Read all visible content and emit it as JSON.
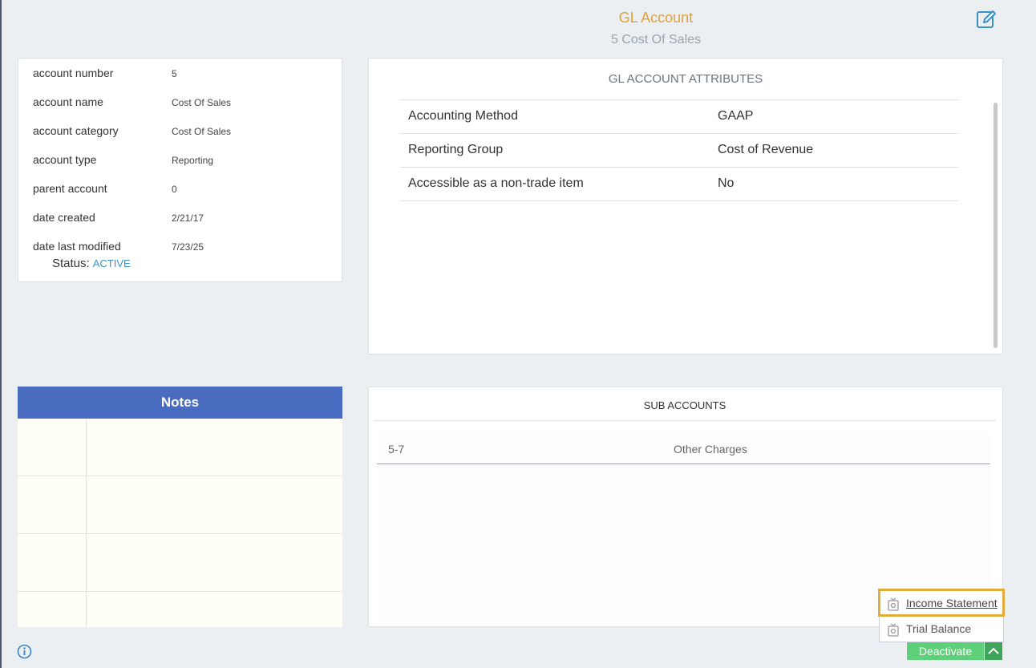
{
  "header": {
    "title": "GL Account",
    "subtitle": "5 Cost Of Sales",
    "edit_icon": "edit-icon"
  },
  "account_info": {
    "rows": [
      {
        "label": "account number",
        "value": "5"
      },
      {
        "label": "account name",
        "value": "Cost Of Sales"
      },
      {
        "label": "account category",
        "value": "Cost Of Sales"
      },
      {
        "label": "account type",
        "value": "Reporting"
      },
      {
        "label": "parent account",
        "value": "0"
      },
      {
        "label": "date created",
        "value": "2/21/17"
      },
      {
        "label": "date last modified",
        "value": "7/23/25"
      }
    ],
    "status_label": "Status:",
    "status_value": "ACTIVE"
  },
  "attributes": {
    "title": "GL ACCOUNT ATTRIBUTES",
    "rows": [
      {
        "name": "Accounting Method",
        "value": "GAAP"
      },
      {
        "name": "Reporting Group",
        "value": "Cost of Revenue"
      },
      {
        "name": "Accessible as a non-trade item",
        "value": "No"
      }
    ]
  },
  "notes": {
    "title": "Notes"
  },
  "sub_accounts": {
    "title": "SUB ACCOUNTS",
    "rows": [
      {
        "number": "5-7",
        "name": "Other Charges"
      }
    ]
  },
  "report_menu": {
    "items": [
      {
        "label": "Income Statement",
        "icon": "report-icon"
      },
      {
        "label": "Trial Balance",
        "icon": "report-icon"
      }
    ]
  },
  "actions": {
    "deactivate_label": "Deactivate"
  },
  "colors": {
    "accent": "#e0a13a",
    "notes_header": "#4a6cc0",
    "status_active": "#3a92c5",
    "deactivate": "#5ed07a"
  }
}
